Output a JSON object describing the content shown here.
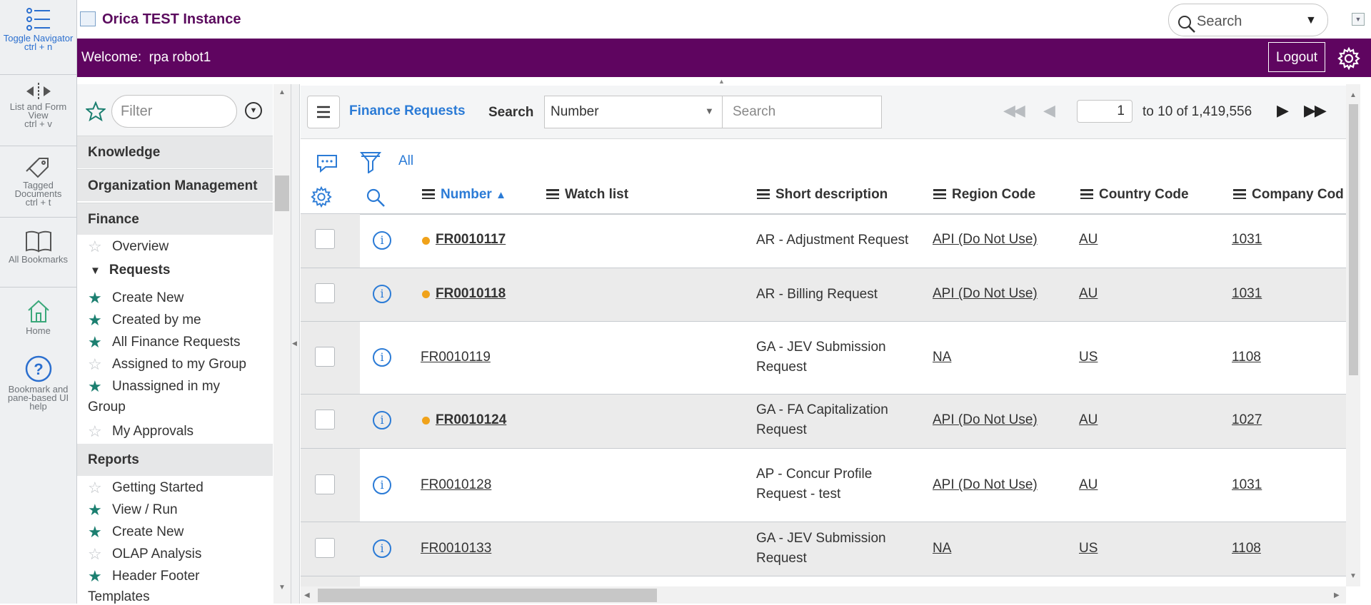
{
  "rail": {
    "toggle_label": "Toggle Navigator",
    "toggle_shortcut": "ctrl + n",
    "listform_label": "List and Form View",
    "listform_shortcut": "ctrl + v",
    "tagged_label": "Tagged Documents",
    "tagged_shortcut": "ctrl + t",
    "bookmarks_label": "All Bookmarks",
    "home_label": "Home",
    "help_label": "Bookmark and pane-based UI help"
  },
  "header": {
    "title": "Orica TEST Instance",
    "search_placeholder": "Search",
    "welcome": "Welcome:  rpa robot1",
    "logout_label": "Logout"
  },
  "navigator": {
    "filter_placeholder": "Filter",
    "sections": {
      "knowledge": "Knowledge",
      "org": "Organization Management",
      "finance": "Finance",
      "reports": "Reports"
    },
    "finance_items": [
      {
        "label": "Overview",
        "starred": false
      },
      {
        "label": "Create New",
        "starred": true
      },
      {
        "label": "Created by me",
        "starred": true
      },
      {
        "label": "All Finance Requests",
        "starred": true
      },
      {
        "label": "Assigned to my Group",
        "starred": false
      },
      {
        "label": "Unassigned in my",
        "starred": true
      },
      {
        "label": "Group",
        "starred": false
      },
      {
        "label": "My Approvals",
        "starred": false
      }
    ],
    "requests_group": "Requests",
    "report_items": [
      {
        "label": "Getting Started",
        "starred": false
      },
      {
        "label": "View / Run",
        "starred": true
      },
      {
        "label": "Create New",
        "starred": true
      },
      {
        "label": "OLAP Analysis",
        "starred": false
      },
      {
        "label": "Header Footer",
        "starred": true
      },
      {
        "label": "Templates",
        "starred": false
      }
    ]
  },
  "list": {
    "title": "Finance Requests",
    "search_label": "Search",
    "search_field": "Number",
    "search_placeholder": "Search",
    "page_input": "1",
    "page_count": "to 10 of 1,419,556",
    "filter_label": "All",
    "columns": [
      "Number",
      "Watch list",
      "Short description",
      "Region Code",
      "Country Code",
      "Company Cod"
    ],
    "rows": [
      {
        "number": "FR0010117",
        "updated": true,
        "desc": "AR - Adjustment Request",
        "region": "API (Do Not Use)",
        "country": "AU",
        "company": "1031"
      },
      {
        "number": "FR0010118",
        "updated": true,
        "desc": "AR - Billing Request",
        "region": "API (Do Not Use)",
        "country": "AU",
        "company": "1031"
      },
      {
        "number": "FR0010119",
        "updated": false,
        "desc": "GA - JEV Submission Request",
        "region": "NA",
        "country": "US",
        "company": "1108"
      },
      {
        "number": "FR0010124",
        "updated": true,
        "desc": "GA - FA Capitalization Request",
        "region": "API (Do Not Use)",
        "country": "AU",
        "company": "1027"
      },
      {
        "number": "FR0010128",
        "updated": false,
        "desc": "AP - Concur Profile Request - test",
        "region": "API (Do Not Use)",
        "country": "AU",
        "company": "1031"
      },
      {
        "number": "FR0010133",
        "updated": false,
        "desc": "GA - JEV Submission Request",
        "region": "NA",
        "country": "US",
        "company": "1108"
      }
    ]
  },
  "colors": {
    "brand_purple": "#5f0560",
    "link_blue": "#2b7bd6",
    "star_teal": "#1b7f70",
    "updated_dot": "#f0a21a"
  }
}
